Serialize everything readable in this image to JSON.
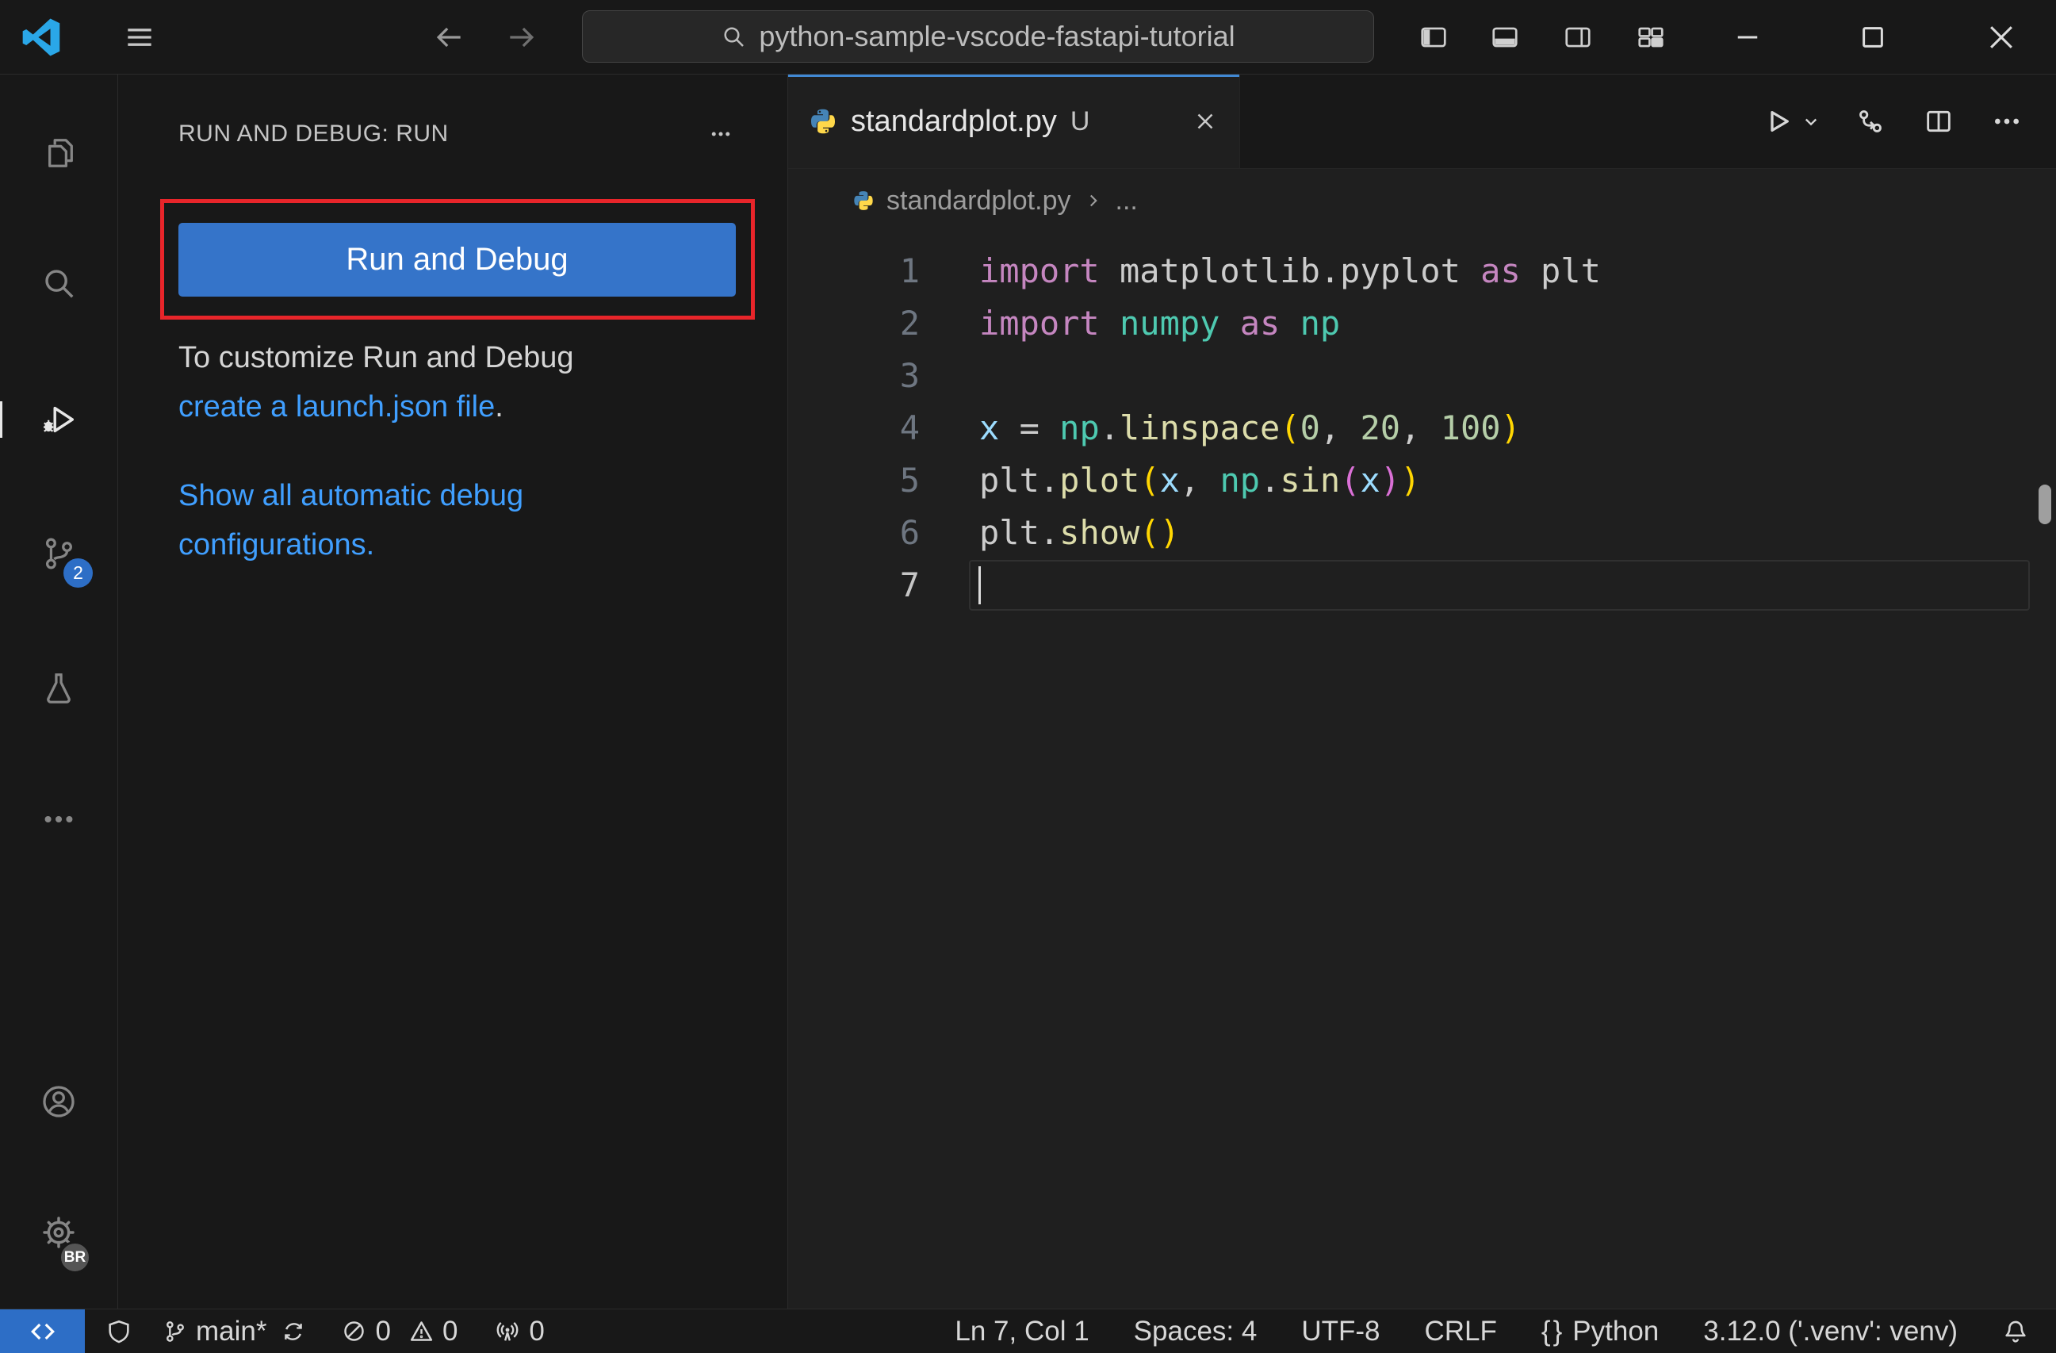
{
  "colors": {
    "accent_button": "#3574c9",
    "remote_blue": "#2d6ec6",
    "link_blue": "#409fff",
    "annotation_red": "#e8252a",
    "tab_active_border": "#4189d4",
    "background_dark": "#181818",
    "background_editor": "#1f1f1f"
  },
  "titlebar": {
    "search_text": "python-sample-vscode-fastapi-tutorial"
  },
  "activity_bar": {
    "scm_badge": "2",
    "profile_badge": "BR"
  },
  "sidebar": {
    "header": "RUN AND DEBUG: RUN",
    "run_button_label": "Run and Debug",
    "customize_prefix": "To customize Run and Debug",
    "customize_link": "create a launch.json file",
    "customize_suffix": ".",
    "show_configs_link": "Show all automatic debug configurations."
  },
  "editor": {
    "tab": {
      "filename": "standardplot.py",
      "git_status": "U"
    },
    "breadcrumb": {
      "filename": "standardplot.py",
      "symbol_path": "..."
    },
    "code": {
      "language": "python",
      "active_line": 7,
      "token_colors": {
        "kw": "#C586C0",
        "mod": "#4EC9B0",
        "fn": "#DCDCAA",
        "var": "#9CDCFE",
        "num": "#B5CEA8",
        "b1": "#FFD602",
        "b2": "#DA70D6",
        "pl": "#CCCCCC"
      },
      "lines": [
        {
          "num": 1,
          "tokens": [
            [
              "import",
              "kw"
            ],
            [
              " matplotlib.pyplot ",
              "pl"
            ],
            [
              "as",
              "kw"
            ],
            [
              " plt",
              "pl"
            ]
          ]
        },
        {
          "num": 2,
          "tokens": [
            [
              "import",
              "kw"
            ],
            [
              " ",
              "pl"
            ],
            [
              "numpy",
              "mod"
            ],
            [
              " ",
              "pl"
            ],
            [
              "as",
              "kw"
            ],
            [
              " ",
              "pl"
            ],
            [
              "np",
              "mod"
            ]
          ]
        },
        {
          "num": 3,
          "tokens": []
        },
        {
          "num": 4,
          "tokens": [
            [
              "x",
              "var"
            ],
            [
              " = ",
              "pl"
            ],
            [
              "np",
              "mod"
            ],
            [
              ".",
              "pl"
            ],
            [
              "linspace",
              "fn"
            ],
            [
              "(",
              "b1"
            ],
            [
              "0",
              "num"
            ],
            [
              ", ",
              "pl"
            ],
            [
              "20",
              "num"
            ],
            [
              ", ",
              "pl"
            ],
            [
              "100",
              "num"
            ],
            [
              ")",
              "b1"
            ]
          ]
        },
        {
          "num": 5,
          "tokens": [
            [
              "plt",
              "pl"
            ],
            [
              ".",
              "pl"
            ],
            [
              "plot",
              "fn"
            ],
            [
              "(",
              "b1"
            ],
            [
              "x",
              "var"
            ],
            [
              ", ",
              "pl"
            ],
            [
              "np",
              "mod"
            ],
            [
              ".",
              "pl"
            ],
            [
              "sin",
              "fn"
            ],
            [
              "(",
              "b2"
            ],
            [
              "x",
              "var"
            ],
            [
              ")",
              "b2"
            ],
            [
              ")",
              "b1"
            ]
          ]
        },
        {
          "num": 6,
          "tokens": [
            [
              "plt",
              "pl"
            ],
            [
              ".",
              "pl"
            ],
            [
              "show",
              "fn"
            ],
            [
              "(",
              "b1"
            ],
            [
              ")",
              "b1"
            ]
          ]
        },
        {
          "num": 7,
          "tokens": []
        }
      ]
    }
  },
  "statusbar": {
    "branch": "main*",
    "errors": "0",
    "warnings": "0",
    "ports": "0",
    "cursor_position": "Ln 7, Col 1",
    "indentation": "Spaces: 4",
    "encoding": "UTF-8",
    "eol": "CRLF",
    "lang_icon": "{}",
    "language": "Python",
    "interpreter": "3.12.0 ('.venv': venv)"
  }
}
